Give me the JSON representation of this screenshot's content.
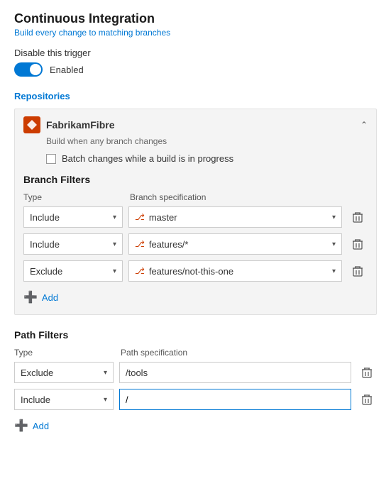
{
  "page": {
    "title": "Continuous Integration",
    "subtitle": "Build every change to matching branches"
  },
  "trigger": {
    "disable_label": "Disable this trigger",
    "toggle_state": "enabled",
    "toggle_label": "Enabled"
  },
  "repositories": {
    "section_title": "Repositories",
    "repo": {
      "name": "FabrikamFibre",
      "description": "Build when any branch changes",
      "batch_label": "Batch changes while a build is in progress"
    }
  },
  "branch_filters": {
    "section_title": "Branch Filters",
    "type_col_label": "Type",
    "spec_col_label": "Branch specification",
    "rows": [
      {
        "type": "Include",
        "spec": "master"
      },
      {
        "type": "Include",
        "spec": "features/*"
      },
      {
        "type": "Exclude",
        "spec": "features/not-this-one"
      }
    ],
    "add_label": "Add"
  },
  "path_filters": {
    "section_title": "Path Filters",
    "type_col_label": "Type",
    "spec_col_label": "Path specification",
    "rows": [
      {
        "type": "Exclude",
        "spec": "/tools",
        "is_input": false
      },
      {
        "type": "Include",
        "spec": "/",
        "is_input": true
      }
    ],
    "add_label": "Add"
  }
}
